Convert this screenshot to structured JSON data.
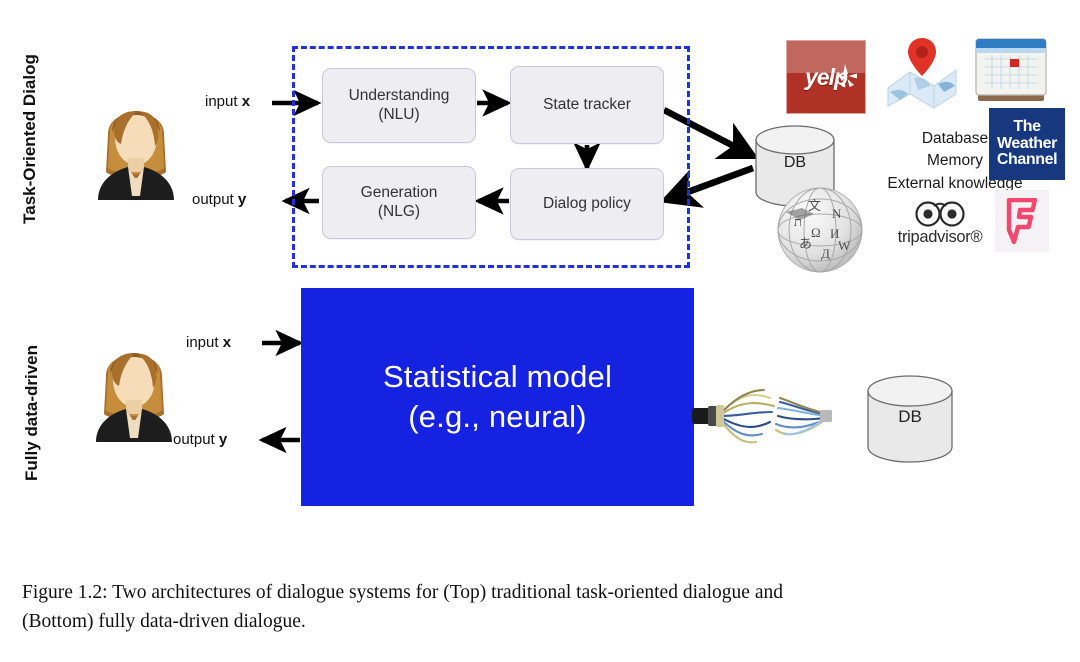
{
  "figure": {
    "rows": [
      {
        "id": "task-oriented",
        "side_label": "Task-Oriented Dialog",
        "input_label": "input",
        "input_var": "x",
        "output_label": "output",
        "output_var": "y",
        "modules": [
          {
            "id": "nlu",
            "line1": "Understanding",
            "line2": "(NLU)"
          },
          {
            "id": "state-tracker",
            "line1": "State tracker",
            "line2": ""
          },
          {
            "id": "nlg",
            "line1": "Generation",
            "line2": "(NLG)"
          },
          {
            "id": "dialog-policy",
            "line1": "Dialog policy",
            "line2": ""
          }
        ],
        "database_label": "DB",
        "knowledge_lines": [
          "Database",
          "Memory",
          "External knowledge"
        ],
        "logos": [
          {
            "id": "yelp",
            "name": "yelp-logo",
            "text": "yelp"
          },
          {
            "id": "map",
            "name": "map-pin-logo",
            "text": ""
          },
          {
            "id": "calendar",
            "name": "calendar-logo",
            "text": ""
          },
          {
            "id": "weather-channel",
            "name": "weather-channel-logo",
            "lines": [
              "The",
              "Weather",
              "Channel"
            ]
          },
          {
            "id": "wikipedia",
            "name": "wikipedia-globe-logo",
            "text": ""
          },
          {
            "id": "tripadvisor",
            "name": "tripadvisor-logo",
            "text": "tripadvisor®"
          },
          {
            "id": "foursquare",
            "name": "foursquare-logo",
            "text": ""
          }
        ]
      },
      {
        "id": "fully-data-driven",
        "side_label": "Fully data-driven",
        "input_label": "input",
        "input_var": "x",
        "output_label": "output",
        "output_var": "y",
        "model_line1": "Statistical model",
        "model_line2": "(e.g., neural)",
        "database_label": "DB"
      }
    ],
    "caption_line1": "Figure 1.2:  Two architectures of dialogue systems for (Top) traditional task-oriented dialogue and",
    "caption_line2": "(Bottom) fully data-driven dialogue."
  },
  "colors": {
    "dashed_border": "#2233d6",
    "model_blue": "#1622e2",
    "module_fill": "#ededf2",
    "module_border": "#c9c9dd",
    "yelp_red": "#b03226",
    "weather_blue": "#17387f",
    "foursquare_pink": "#f4476f",
    "arrow_black": "#000000"
  }
}
